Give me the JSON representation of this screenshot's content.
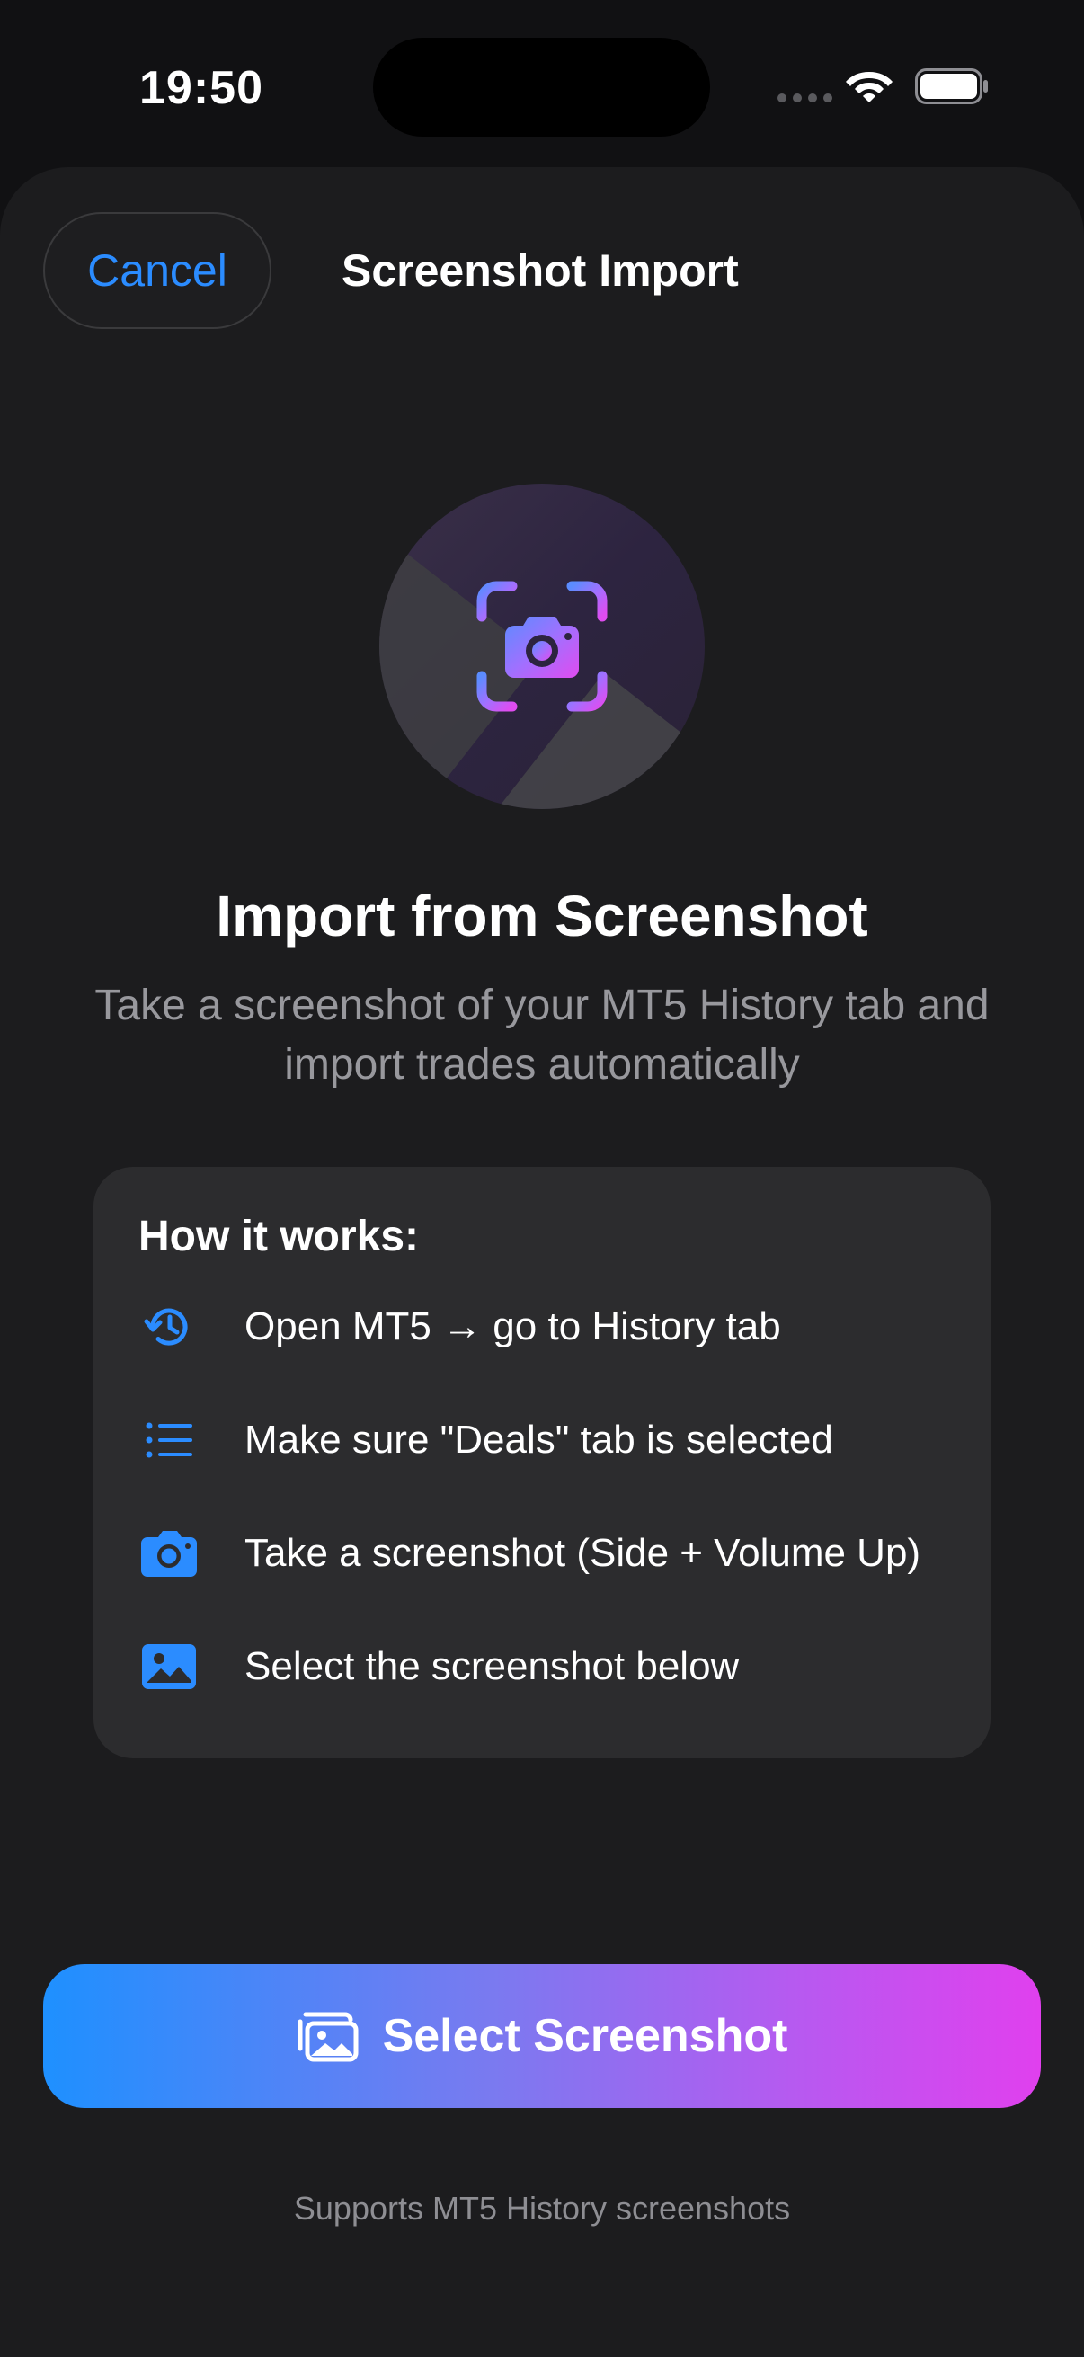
{
  "status_bar": {
    "time": "19:50"
  },
  "header": {
    "cancel_label": "Cancel",
    "title": "Screenshot Import"
  },
  "hero": {
    "icon": "camera-viewfinder-icon",
    "title": "Import from Screenshot",
    "subtitle": "Take a screenshot of your MT5 History tab and import trades automatically"
  },
  "how_it_works": {
    "title": "How it works:",
    "steps": [
      {
        "icon": "history-clock-icon",
        "text": "Open MT5 → go to History tab"
      },
      {
        "icon": "list-icon",
        "text": "Make sure \"Deals\" tab is selected"
      },
      {
        "icon": "camera-icon",
        "text": "Take a screenshot (Side + Volume Up)"
      },
      {
        "icon": "photo-icon",
        "text": "Select the screenshot below"
      }
    ]
  },
  "action": {
    "button_label": "Select Screenshot",
    "button_icon": "photo-stack-icon",
    "footnote": "Supports MT5 History screenshots"
  },
  "colors": {
    "accent_blue": "#2b8cff",
    "gradient_start": "#1e90ff",
    "gradient_end": "#e040ee",
    "sheet_background": "#1c1c1e",
    "card_background": "#2c2c2e"
  }
}
